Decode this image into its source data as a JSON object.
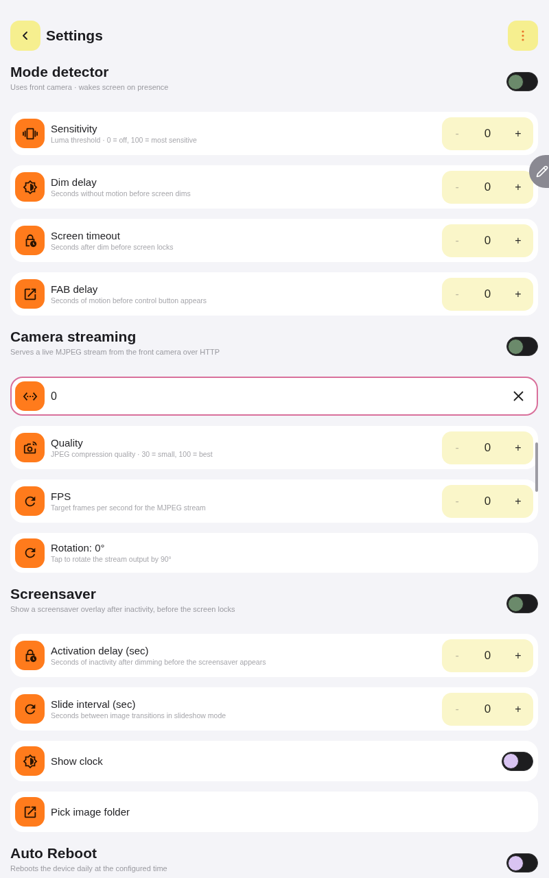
{
  "header": {
    "title": "Settings"
  },
  "sections": [
    {
      "title": "Mode detector",
      "subtitle": "Uses front camera · wakes screen on presence",
      "toggle": {
        "on": false,
        "color": "#6b8a6b"
      },
      "rows": [
        {
          "kind": "stepper",
          "title": "Sensitivity",
          "subtitle": "Luma threshold · 0 = off, 100 = most sensitive",
          "stepper": {
            "minus": "-",
            "value": "0",
            "plus": "+",
            "minus_disabled": true
          }
        },
        {
          "kind": "stepper",
          "title": "Dim delay",
          "subtitle": "Seconds without motion before screen dims",
          "stepper": {
            "minus": "-",
            "value": "0",
            "plus": "+",
            "minus_disabled": true
          }
        },
        {
          "kind": "stepper",
          "title": "Screen timeout",
          "subtitle": "Seconds after dim before screen locks",
          "stepper": {
            "minus": "-",
            "value": "0",
            "plus": "+",
            "minus_disabled": true
          }
        },
        {
          "kind": "stepper",
          "title": "FAB delay",
          "subtitle": "Seconds of motion before control button appears",
          "stepper": {
            "minus": "-",
            "value": "0",
            "plus": "+",
            "minus_disabled": true
          }
        }
      ]
    },
    {
      "title": "Camera streaming",
      "subtitle": "Serves a live MJPEG stream from the front camera over HTTP",
      "toggle": {
        "on": false,
        "color": "#6b8a6b"
      },
      "rows": [
        {
          "kind": "input",
          "value": "0",
          "focused": true
        },
        {
          "kind": "stepper",
          "title": "Quality",
          "subtitle": "JPEG compression quality · 30 = small, 100 = best",
          "stepper": {
            "minus": "-",
            "value": "0",
            "plus": "+",
            "minus_disabled": true
          }
        },
        {
          "kind": "stepper",
          "title": "FPS",
          "subtitle": "Target frames per second for the MJPEG stream",
          "stepper": {
            "minus": "-",
            "value": "0",
            "plus": "+",
            "minus_disabled": true
          }
        },
        {
          "kind": "action",
          "title": "Rotation: 0°",
          "subtitle": "Tap to rotate the stream output by 90°"
        }
      ]
    },
    {
      "title": "Screensaver",
      "subtitle": "Show a screensaver overlay after inactivity, before the screen locks",
      "toggle": {
        "on": false,
        "color": "#6b8a6b"
      },
      "rows": [
        {
          "kind": "stepper",
          "title": "Activation delay (sec)",
          "subtitle": "Seconds of inactivity after dimming before the screensaver appears",
          "stepper": {
            "minus": "-",
            "value": "0",
            "plus": "+",
            "minus_disabled": true
          }
        },
        {
          "kind": "stepper",
          "title": "Slide interval (sec)",
          "subtitle": "Seconds between image transitions in slideshow mode",
          "stepper": {
            "minus": "-",
            "value": "0",
            "plus": "+",
            "minus_disabled": true
          }
        },
        {
          "kind": "toggle",
          "title": "Show clock",
          "toggle": {
            "on": false,
            "color": "#d9c4f2"
          }
        },
        {
          "kind": "action",
          "title": "Pick image folder"
        }
      ]
    },
    {
      "title": "Auto Reboot",
      "subtitle": "Reboots the device daily at the configured time",
      "toggle": {
        "on": false,
        "color": "#d9c4f2"
      }
    }
  ]
}
